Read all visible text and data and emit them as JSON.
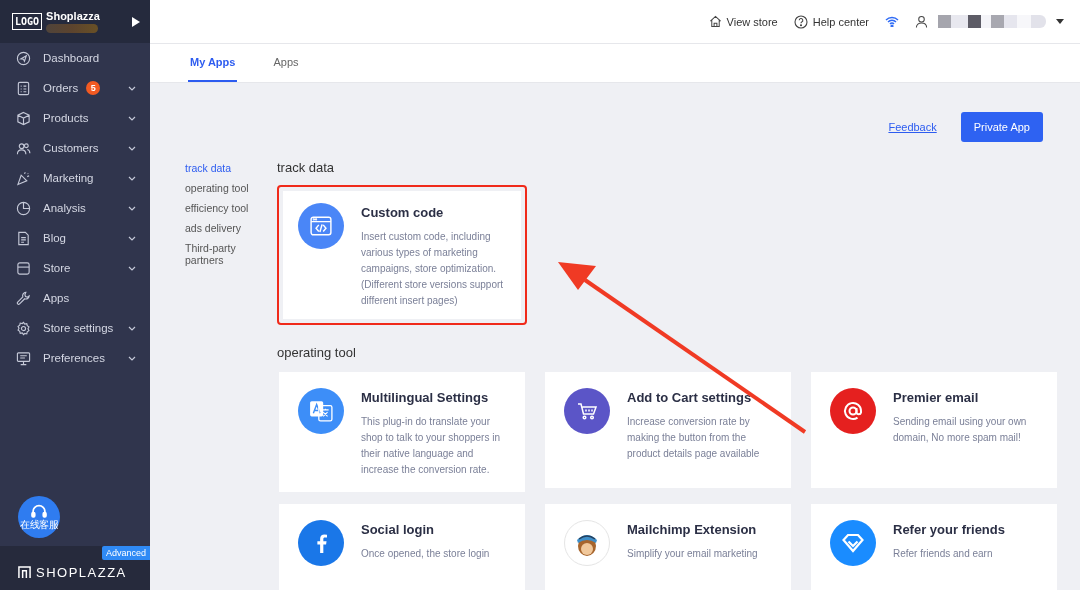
{
  "sidebar": {
    "logo_text": "LOGO",
    "shop_name": "Shoplazza",
    "items": [
      {
        "label": "Dashboard",
        "expandable": false
      },
      {
        "label": "Orders",
        "badge": "5",
        "expandable": true
      },
      {
        "label": "Products",
        "expandable": true
      },
      {
        "label": "Customers",
        "expandable": true
      },
      {
        "label": "Marketing",
        "expandable": true
      },
      {
        "label": "Analysis",
        "expandable": true
      },
      {
        "label": "Blog",
        "expandable": true
      },
      {
        "label": "Store",
        "expandable": true
      },
      {
        "label": "Apps",
        "expandable": false
      },
      {
        "label": "Store settings",
        "expandable": true
      },
      {
        "label": "Preferences",
        "expandable": true
      }
    ],
    "support_label": "在线客服",
    "brand": "SHOPLAZZA",
    "plan_badge": "Advanced"
  },
  "topbar": {
    "links": [
      "View store",
      "Help center"
    ]
  },
  "tabs": [
    {
      "label": "My Apps",
      "selected": true
    },
    {
      "label": "Apps",
      "selected": false
    }
  ],
  "actions": {
    "link": "Feedback",
    "button": "Private App"
  },
  "categories": [
    {
      "label": "track data",
      "selected": true
    },
    {
      "label": "operating tool",
      "selected": false
    },
    {
      "label": "efficiency tool",
      "selected": false
    },
    {
      "label": "ads delivery",
      "selected": false
    },
    {
      "label": "Third-party partners",
      "selected": false
    }
  ],
  "sections": [
    {
      "title": "track data",
      "cards": [
        {
          "title": "Custom code",
          "description": "Insert custom code, including various types of marketing campaigns, store optimization. (Different store versions support different insert pages)",
          "color": "#4a86f7",
          "highlighted": true
        }
      ]
    },
    {
      "title": "operating tool",
      "cards": [
        {
          "title": "Multilingual Settings",
          "description": "This plug-in do translate your shop to talk to your shoppers in their native language and increase the conversion rate.",
          "color": "#3d8ef8",
          "highlighted": false
        },
        {
          "title": "Add to Cart settings",
          "description": "Increase conversion rate by making the button from the product details page available",
          "color": "#5b55c7",
          "highlighted": false
        },
        {
          "title": "Premier email",
          "description": "Sending email using your own domain, No more spam mail!",
          "color": "#e5201f",
          "highlighted": false
        },
        {
          "title": "Social login",
          "description": "Once opened, the store login",
          "color": "#1a77e8",
          "highlighted": false
        },
        {
          "title": "Mailchimp Extension",
          "description": "Simplify your email marketing",
          "color": "#ffffff",
          "highlighted": false
        },
        {
          "title": "Refer your friends",
          "description": "Refer friends and earn",
          "color": "#1a8cff",
          "highlighted": false
        }
      ]
    }
  ]
}
